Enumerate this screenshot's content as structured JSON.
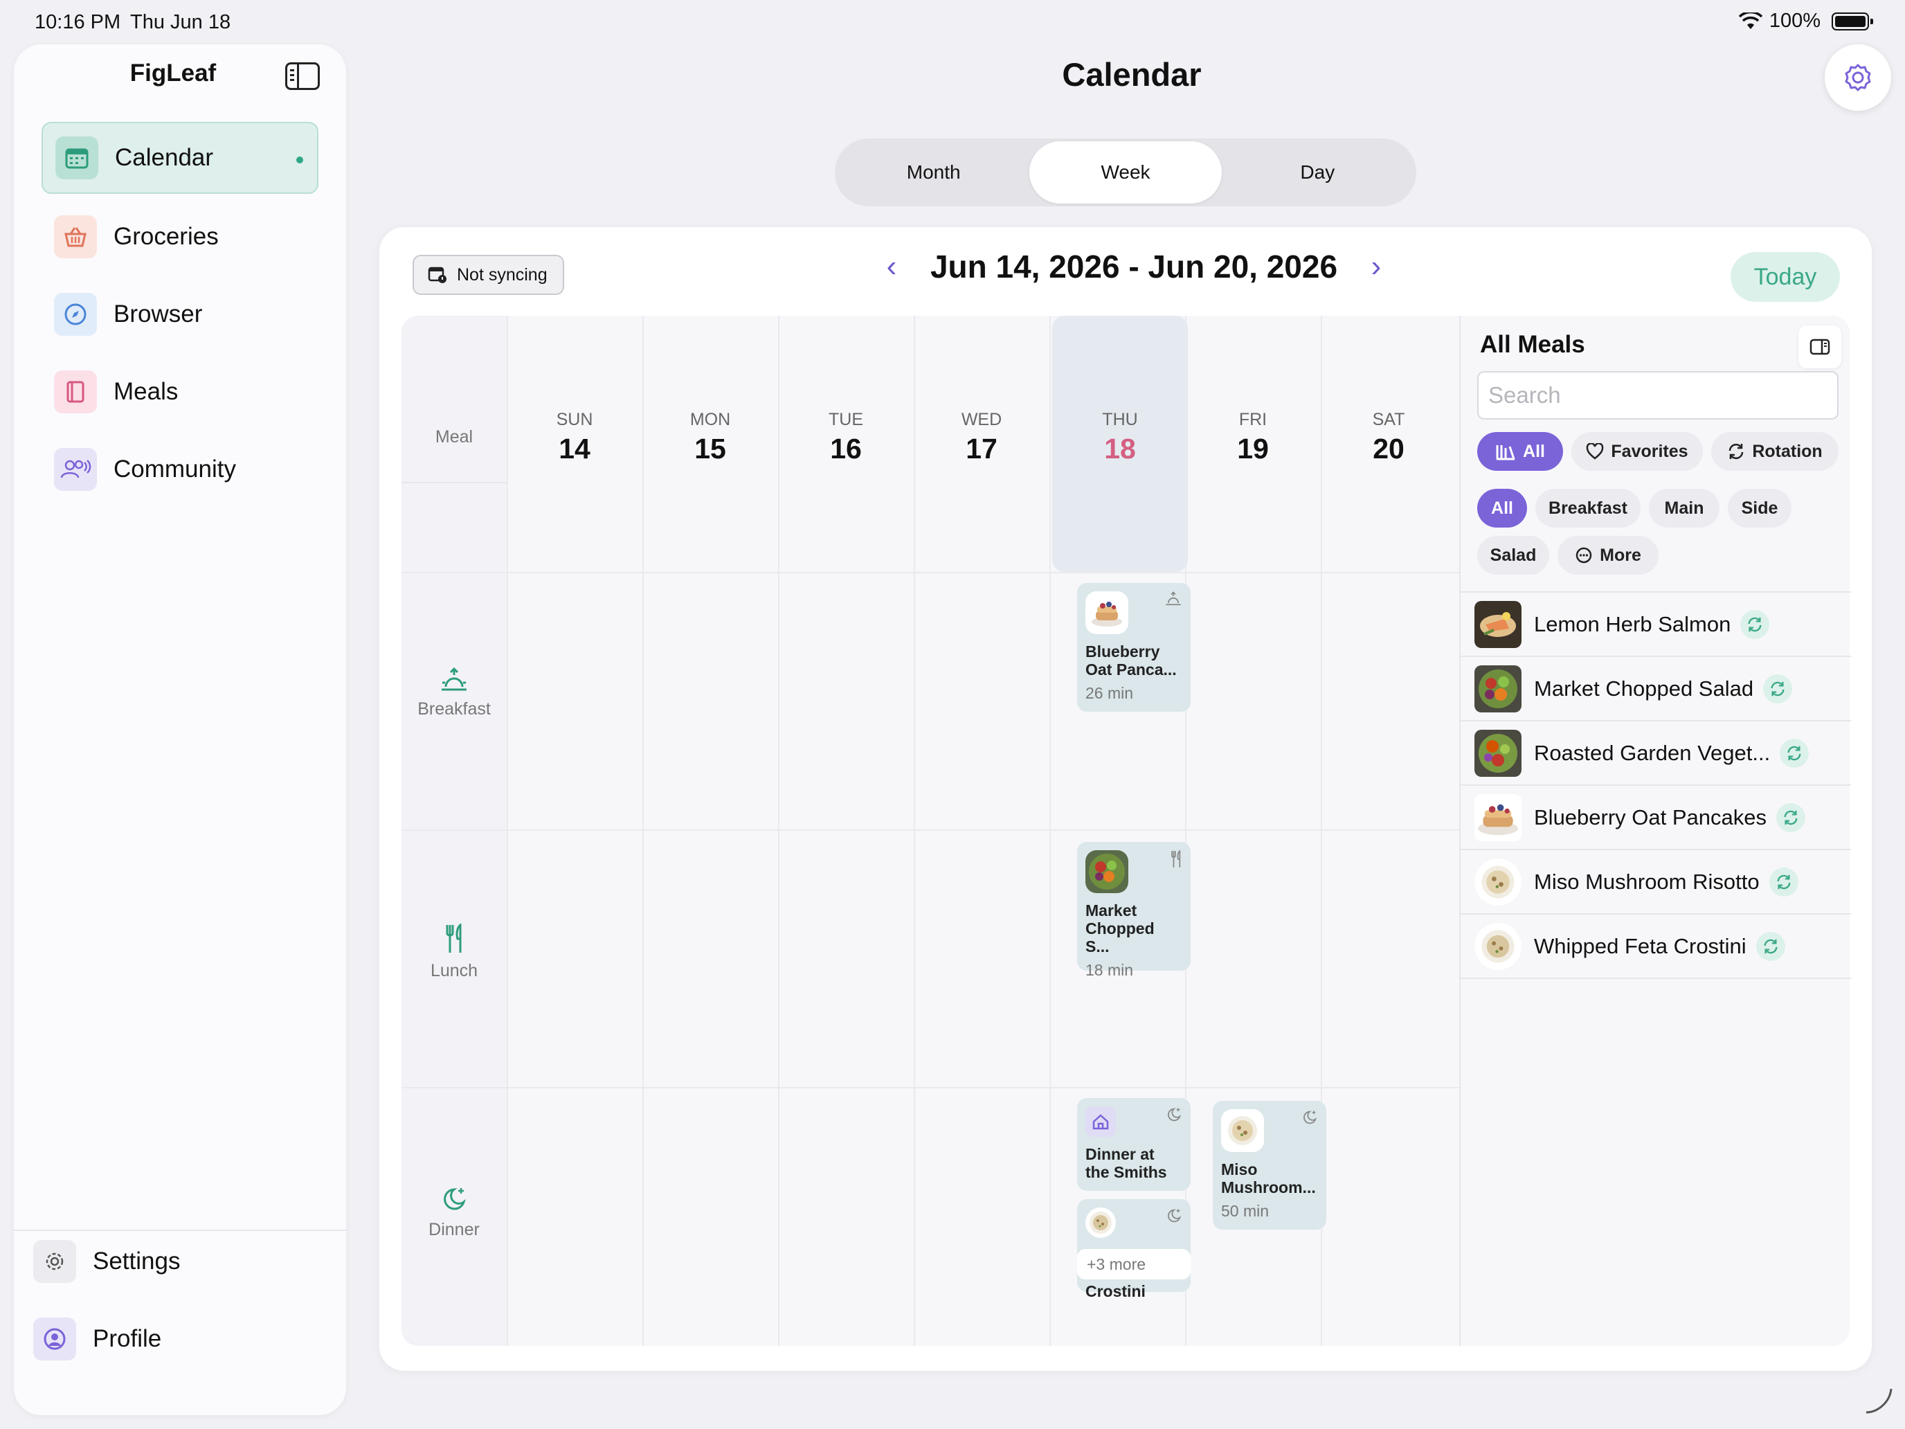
{
  "status_bar": {
    "time": "10:16 PM",
    "date": "Thu Jun 18",
    "battery": "100%"
  },
  "sidebar": {
    "app_name": "FigLeaf",
    "items": [
      {
        "label": "Calendar",
        "icon": "calendar-icon",
        "active": true
      },
      {
        "label": "Groceries",
        "icon": "basket-icon"
      },
      {
        "label": "Browser",
        "icon": "compass-icon"
      },
      {
        "label": "Meals",
        "icon": "book-icon"
      },
      {
        "label": "Community",
        "icon": "people-icon"
      }
    ],
    "bottom": [
      {
        "label": "Settings",
        "icon": "gear-icon"
      },
      {
        "label": "Profile",
        "icon": "person-icon"
      }
    ]
  },
  "header": {
    "title": "Calendar"
  },
  "view_switcher": {
    "options": [
      "Month",
      "Week",
      "Day"
    ],
    "selected": "Week"
  },
  "calendar": {
    "sync_status": "Not syncing",
    "range": "Jun 14, 2026 - Jun 20, 2026",
    "today_label": "Today",
    "meal_header": "Meal",
    "days": [
      {
        "name": "SUN",
        "num": "14"
      },
      {
        "name": "MON",
        "num": "15"
      },
      {
        "name": "TUE",
        "num": "16"
      },
      {
        "name": "WED",
        "num": "17"
      },
      {
        "name": "THU",
        "num": "18",
        "today": true
      },
      {
        "name": "FRI",
        "num": "19"
      },
      {
        "name": "SAT",
        "num": "20"
      }
    ],
    "meal_types": [
      "Breakfast",
      "Lunch",
      "Dinner"
    ],
    "entries": {
      "thu_breakfast": {
        "name": "Blueberry Oat Panca...",
        "time": "26 min"
      },
      "thu_lunch": {
        "name": "Market Chopped S...",
        "time": "18 min"
      },
      "thu_dinner_1": {
        "name": "Dinner at the Smiths"
      },
      "thu_dinner_2": {
        "name": "Whipped Feta Crostini"
      },
      "thu_dinner_more": "+3 more",
      "fri_dinner": {
        "name": "Miso Mushroom...",
        "time": "50 min"
      }
    }
  },
  "panel": {
    "title": "All Meals",
    "search_placeholder": "Search",
    "filters": [
      "All",
      "Favorites",
      "Rotation"
    ],
    "categories": [
      "All",
      "Breakfast",
      "Main",
      "Side",
      "Salad",
      "More"
    ],
    "meals": [
      "Lemon Herb Salmon",
      "Market Chopped Salad",
      "Roasted Garden Veget...",
      "Blueberry Oat Pancakes",
      "Miso Mushroom Risotto",
      "Whipped Feta Crostini"
    ]
  },
  "colors": {
    "accent": "#7b63d8",
    "mint": "#3aa888",
    "today": "#d45f82"
  }
}
